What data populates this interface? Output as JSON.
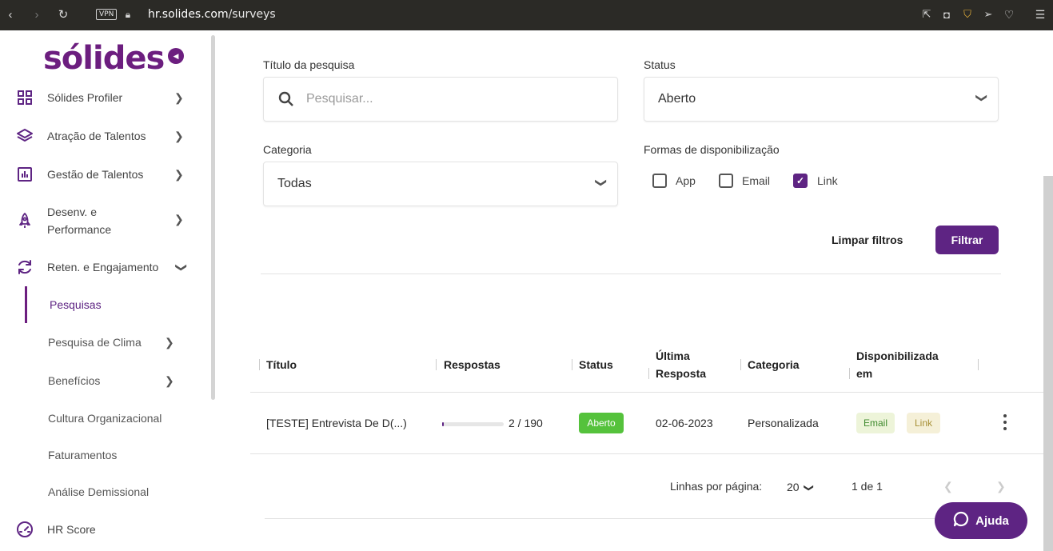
{
  "browser": {
    "vpn": "VPN",
    "url_host": "hr.solides.com",
    "url_path": "/surveys"
  },
  "sidebar": {
    "logo": "sólides",
    "items": [
      {
        "label": "Sólides Profiler",
        "icon": "grid-icon"
      },
      {
        "label": "Atração de Talentos",
        "icon": "layers-icon"
      },
      {
        "label": "Gestão de Talentos",
        "icon": "chart-icon"
      },
      {
        "label": "Desenv. e",
        "label2": "Performance",
        "icon": "rocket-icon"
      },
      {
        "label": "Reten. e Engajamento",
        "icon": "refresh-icon"
      }
    ],
    "subitems": [
      "Pesquisas",
      "Pesquisa de Clima",
      "Benefícios",
      "Cultura Organizacional",
      "Faturamentos",
      "Análise Demissional"
    ],
    "hr_score": "HR Score"
  },
  "filters": {
    "title_label": "Título da pesquisa",
    "search_placeholder": "Pesquisar...",
    "status_label": "Status",
    "status_value": "Aberto",
    "category_label": "Categoria",
    "category_value": "Todas",
    "availability_label": "Formas de disponibilização",
    "options": [
      {
        "label": "App",
        "checked": false
      },
      {
        "label": "Email",
        "checked": false
      },
      {
        "label": "Link",
        "checked": true
      }
    ],
    "clear_label": "Limpar filtros",
    "filter_label": "Filtrar"
  },
  "table": {
    "headers": {
      "title": "Título",
      "responses": "Respostas",
      "status": "Status",
      "last1": "Última",
      "last2": "Resposta",
      "category": "Categoria",
      "avail1": "Disponibilizada",
      "avail2": "em"
    },
    "rows": [
      {
        "title": "[TESTE] Entrevista De D(...)",
        "responses": "2 / 190",
        "progress": 0.0105,
        "status": "Aberto",
        "last_response": "02-06-2023",
        "category": "Personalizada",
        "tag1": "Email",
        "tag2": "Link"
      }
    ],
    "pagination": {
      "rows_label": "Linhas por página:",
      "rows_value": "20",
      "range": "1 de 1"
    }
  },
  "help": {
    "label": "Ajuda"
  }
}
